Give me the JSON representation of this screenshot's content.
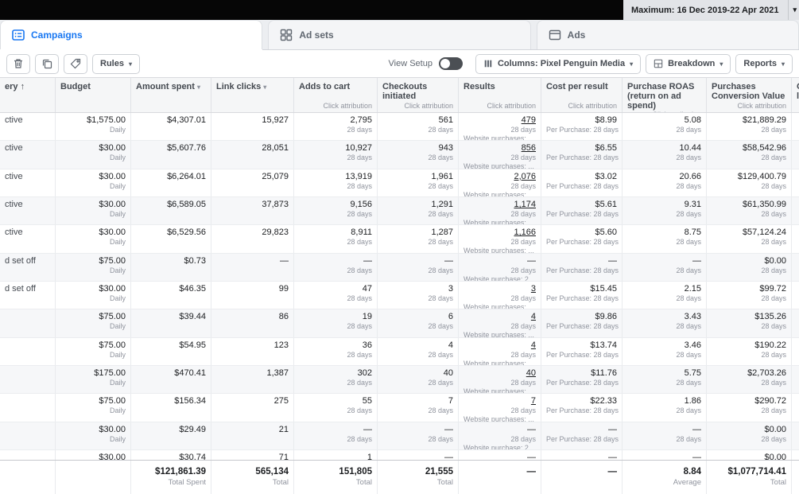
{
  "topbar": {
    "date_range": "Maximum: 16 Dec 2019-22 Apr 2021"
  },
  "icons": {
    "chevron_down": "▾"
  },
  "tabs": [
    {
      "label": "Campaigns"
    },
    {
      "label": "Ad sets"
    },
    {
      "label": "Ads"
    }
  ],
  "toolbar": {
    "rules_label": "Rules",
    "view_setup_label": "View Setup",
    "columns_label": "Columns: Pixel Penguin Media",
    "breakdown_label": "Breakdown",
    "reports_label": "Reports"
  },
  "table": {
    "period_label": "28 days",
    "budget_sub_label": "Daily",
    "cost_sub_label": "Per Purchase: 28 days",
    "columns": [
      {
        "id": "delivery",
        "label": "ery ↑",
        "sub": "",
        "align": "left"
      },
      {
        "id": "budget",
        "label": "Budget",
        "sub": ""
      },
      {
        "id": "amount-spent",
        "label": "Amount spent",
        "sub": "",
        "sortable": true
      },
      {
        "id": "link-clicks",
        "label": "Link clicks",
        "sub": "",
        "sortable": true
      },
      {
        "id": "adds-to-cart",
        "label": "Adds to cart",
        "sub": "Click attribution"
      },
      {
        "id": "checkouts-initiated",
        "label": "Checkouts initiated",
        "sub": "Click attribution"
      },
      {
        "id": "results",
        "label": "Results",
        "sub": "Click attribution"
      },
      {
        "id": "cost-per-result",
        "label": "Cost per result",
        "sub": "Click attribution"
      },
      {
        "id": "purchase-roas",
        "label": "Purchase ROAS (return on ad spend)",
        "sub": "Click attribution"
      },
      {
        "id": "purchases-conversion-value",
        "label": "Purchases Conversion Value",
        "sub": "Click attribution"
      },
      {
        "id": "cut",
        "label": "C li",
        "sub": ""
      }
    ],
    "rows": [
      {
        "delivery": "ctive",
        "budget": "$1,575.00",
        "amount_spent": "$4,307.01",
        "link_clicks": "15,927",
        "adds_to_cart": "2,795",
        "checkouts": "561",
        "results": "479",
        "results_note": "Website purchases: ...",
        "cost": "$8.99",
        "roas": "5.08",
        "conv": "$21,889.29"
      },
      {
        "delivery": "ctive",
        "budget": "$30.00",
        "amount_spent": "$5,607.76",
        "link_clicks": "28,051",
        "adds_to_cart": "10,927",
        "checkouts": "943",
        "results": "856",
        "results_note": "Website purchases: ...",
        "cost": "$6.55",
        "roas": "10.44",
        "conv": "$58,542.96"
      },
      {
        "delivery": "ctive",
        "budget": "$30.00",
        "amount_spent": "$6,264.01",
        "link_clicks": "25,079",
        "adds_to_cart": "13,919",
        "checkouts": "1,961",
        "results": "2,076",
        "results_note": "Website purchases: ...",
        "cost": "$3.02",
        "roas": "20.66",
        "conv": "$129,400.79"
      },
      {
        "delivery": "ctive",
        "budget": "$30.00",
        "amount_spent": "$6,589.05",
        "link_clicks": "37,873",
        "adds_to_cart": "9,156",
        "checkouts": "1,291",
        "results": "1,174",
        "results_note": "Website purchases: ...",
        "cost": "$5.61",
        "roas": "9.31",
        "conv": "$61,350.99"
      },
      {
        "delivery": "ctive",
        "budget": "$30.00",
        "amount_spent": "$6,529.56",
        "link_clicks": "29,823",
        "adds_to_cart": "8,911",
        "checkouts": "1,287",
        "results": "1,166",
        "results_note": "Website purchases: ...",
        "cost": "$5.60",
        "roas": "8.75",
        "conv": "$57,124.24"
      },
      {
        "delivery": "d set off",
        "budget": "$75.00",
        "amount_spent": "$0.73",
        "link_clicks": "—",
        "adds_to_cart": "—",
        "checkouts": "—",
        "results": "—",
        "results_note": "Website purchase: 2...",
        "cost": "—",
        "roas": "—",
        "conv": "$0.00"
      },
      {
        "delivery": "d set off",
        "budget": "$30.00",
        "amount_spent": "$46.35",
        "link_clicks": "99",
        "adds_to_cart": "47",
        "checkouts": "3",
        "results": "3",
        "results_note": "Website purchases: ...",
        "cost": "$15.45",
        "roas": "2.15",
        "conv": "$99.72"
      },
      {
        "delivery": "",
        "budget": "$75.00",
        "amount_spent": "$39.44",
        "link_clicks": "86",
        "adds_to_cart": "19",
        "checkouts": "6",
        "results": "4",
        "results_note": "Website purchases: ...",
        "cost": "$9.86",
        "roas": "3.43",
        "conv": "$135.26"
      },
      {
        "delivery": "",
        "budget": "$75.00",
        "amount_spent": "$54.95",
        "link_clicks": "123",
        "adds_to_cart": "36",
        "checkouts": "4",
        "results": "4",
        "results_note": "Website purchases: ...",
        "cost": "$13.74",
        "roas": "3.46",
        "conv": "$190.22"
      },
      {
        "delivery": "",
        "budget": "$175.00",
        "amount_spent": "$470.41",
        "link_clicks": "1,387",
        "adds_to_cart": "302",
        "checkouts": "40",
        "results": "40",
        "results_note": "Website purchases: ...",
        "cost": "$11.76",
        "roas": "5.75",
        "conv": "$2,703.26"
      },
      {
        "delivery": "",
        "budget": "$75.00",
        "amount_spent": "$156.34",
        "link_clicks": "275",
        "adds_to_cart": "55",
        "checkouts": "7",
        "results": "7",
        "results_note": "Website purchases: ...",
        "cost": "$22.33",
        "roas": "1.86",
        "conv": "$290.72"
      },
      {
        "delivery": "",
        "budget": "$30.00",
        "amount_spent": "$29.49",
        "link_clicks": "21",
        "adds_to_cart": "—",
        "checkouts": "—",
        "results": "—",
        "results_note": "Website purchase: 2...",
        "cost": "—",
        "roas": "—",
        "conv": "$0.00"
      },
      {
        "delivery": "",
        "budget": "$30.00",
        "amount_spent": "$30.74",
        "link_clicks": "71",
        "adds_to_cart": "1",
        "checkouts": "—",
        "results": "—",
        "results_note": "",
        "cost": "—",
        "roas": "—",
        "conv": "$0.00"
      }
    ],
    "footer": {
      "amount_spent": {
        "value": "$121,861.39",
        "label": "Total Spent"
      },
      "link_clicks": {
        "value": "565,134",
        "label": "Total"
      },
      "adds_to_cart": {
        "value": "151,805",
        "label": "Total"
      },
      "checkouts_initiated": {
        "value": "21,555",
        "label": "Total"
      },
      "results": {
        "value": "—",
        "label": ""
      },
      "cost_per_result": {
        "value": "—",
        "label": ""
      },
      "purchase_roas": {
        "value": "8.84",
        "label": "Average"
      },
      "purchases_conversion_value": {
        "value": "$1,077,714.41",
        "label": "Total"
      }
    }
  }
}
